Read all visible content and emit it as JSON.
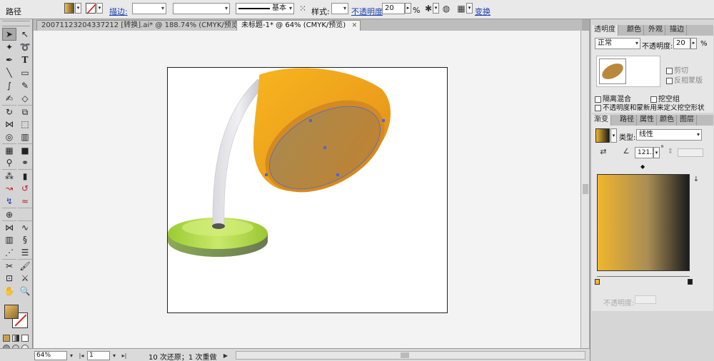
{
  "control_bar": {
    "object_type": "路径",
    "stroke_label": "描边:",
    "stroke_profile": "基本",
    "style_label": "样式:",
    "opacity_label": "不透明度",
    "opacity_value": "20",
    "opacity_unit": "%",
    "transform_label": "变换"
  },
  "tabs": [
    {
      "label": "20071123204337212 [转换].ai* @ 188.74% (CMYK/预览)"
    },
    {
      "label": "未标题-1* @ 64% (CMYK/预览)"
    }
  ],
  "status": {
    "zoom": "64%",
    "page": "1",
    "history": "10 次还原；1 次重做"
  },
  "transparency_panel": {
    "tabs": [
      "透明度",
      "颜色",
      "外观",
      "描边"
    ],
    "blend_mode": "正常",
    "opacity_label": "不透明度:",
    "opacity_value": "20",
    "opacity_unit": "%",
    "clip_label": "剪切",
    "invert_mask_label": "反相蒙版",
    "isolate_blend_label": "隔离混合",
    "knockout_group_label": "挖空组",
    "opacity_mask_label": "不透明度和蒙新用来定义挖空形状"
  },
  "gradient_panel": {
    "tabs": [
      "渐变",
      "路径",
      "属性",
      "颜色",
      "图层"
    ],
    "type_label": "类型:",
    "type_value": "线性",
    "angle_value": "121.3",
    "angle_unit": "°",
    "stop_opacity_label": "不透明度:",
    "stop_colors": [
      "#f2b62c",
      "#1b1b1b"
    ]
  },
  "colors": {
    "lamp_shade": "#f0a020",
    "lamp_base": "#9fce3a",
    "gradient_start": "#f2b62c",
    "gradient_end": "#1b1b1b"
  }
}
